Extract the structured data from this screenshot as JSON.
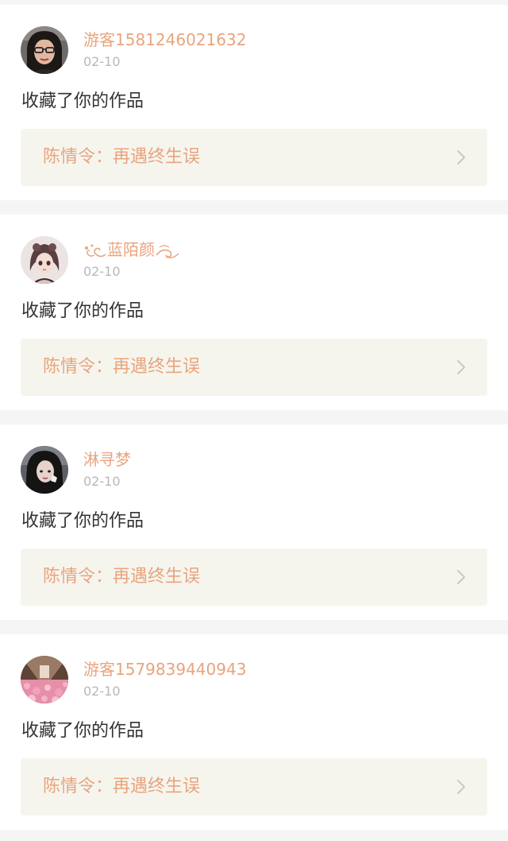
{
  "notifications": [
    {
      "username": "游客1581246021632",
      "date": "02-10",
      "action": "收藏了你的作品",
      "work_title": "陈情令：再遇终生误",
      "avatar_icon": "avatar-woman-glasses"
    },
    {
      "username": "蓝陌颜",
      "date": "02-10",
      "action": "收藏了你的作品",
      "work_title": "陈情令：再遇终生误",
      "avatar_icon": "avatar-anime-girl"
    },
    {
      "username": "淋寻梦",
      "date": "02-10",
      "action": "收藏了你的作品",
      "work_title": "陈情令：再遇终生误",
      "avatar_icon": "avatar-dark-hair-girl"
    },
    {
      "username": "游客1579839440943",
      "date": "02-10",
      "action": "收藏了你的作品",
      "work_title": "陈情令：再遇终生误",
      "avatar_icon": "avatar-flower-field"
    }
  ],
  "colors": {
    "accent": "#e8a47e",
    "date": "#b8b8b8",
    "text": "#333333",
    "box": "#f6f5ed",
    "background": "#f5f5f5"
  }
}
